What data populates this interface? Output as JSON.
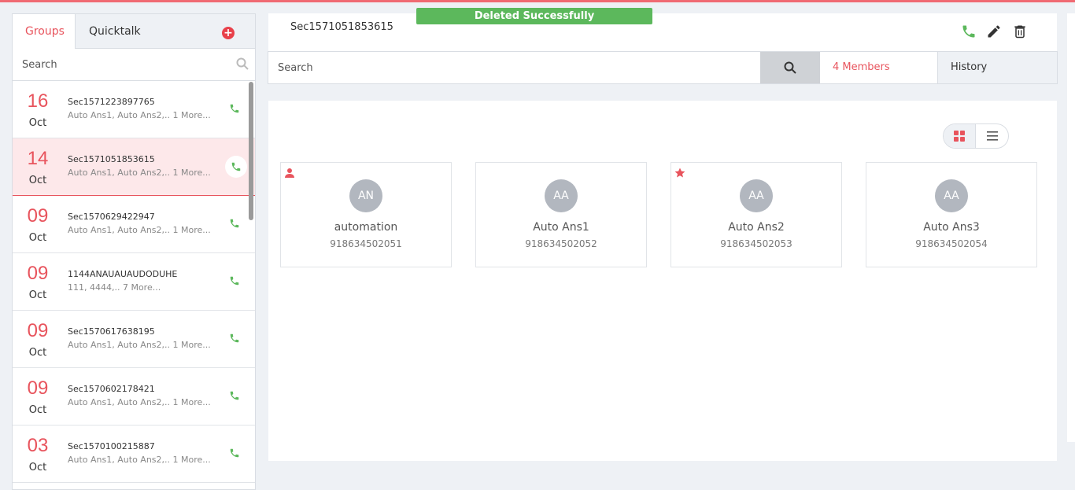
{
  "toast": {
    "message": "Deleted Successfully"
  },
  "left_panel": {
    "tabs": [
      {
        "label": "Groups",
        "active": true
      },
      {
        "label": "Quicktalk",
        "active": false
      }
    ],
    "search_placeholder": "Search",
    "groups": [
      {
        "day": "16",
        "month": "Oct",
        "name": "Sec1571223897765",
        "members": "Auto Ans1, Auto Ans2,.. 1 More...",
        "selected": false
      },
      {
        "day": "14",
        "month": "Oct",
        "name": "Sec1571051853615",
        "members": "Auto Ans1, Auto Ans2,.. 1 More...",
        "selected": true
      },
      {
        "day": "09",
        "month": "Oct",
        "name": "Sec1570629422947",
        "members": "Auto Ans1, Auto Ans2,.. 1 More...",
        "selected": false
      },
      {
        "day": "09",
        "month": "Oct",
        "name": "1144ANAUAUAUDODUHE",
        "members": "111, 4444,.. 7 More...",
        "selected": false
      },
      {
        "day": "09",
        "month": "Oct",
        "name": "Sec1570617638195",
        "members": "Auto Ans1, Auto Ans2,.. 1 More...",
        "selected": false
      },
      {
        "day": "09",
        "month": "Oct",
        "name": "Sec1570602178421",
        "members": "Auto Ans1, Auto Ans2,.. 1 More...",
        "selected": false
      },
      {
        "day": "03",
        "month": "Oct",
        "name": "Sec1570100215887",
        "members": "Auto Ans1, Auto Ans2,.. 1 More...",
        "selected": false
      }
    ]
  },
  "header": {
    "title": "Sec1571051853615"
  },
  "toolbar": {
    "search_placeholder": "Search",
    "members_label": "4 Members",
    "history_label": "History"
  },
  "members": [
    {
      "initials": "AN",
      "name": "automation",
      "phone": "918634502051",
      "badge": "user-icon"
    },
    {
      "initials": "AA",
      "name": "Auto Ans1",
      "phone": "918634502052",
      "badge": ""
    },
    {
      "initials": "AA",
      "name": "Auto Ans2",
      "phone": "918634502053",
      "badge": "star-icon"
    },
    {
      "initials": "AA",
      "name": "Auto Ans3",
      "phone": "918634502054",
      "badge": ""
    }
  ],
  "colors": {
    "accent": "#e8545d",
    "call_green": "#5cb85c",
    "toast_green": "#5cb85c",
    "selected_bg": "#fde8ea"
  }
}
